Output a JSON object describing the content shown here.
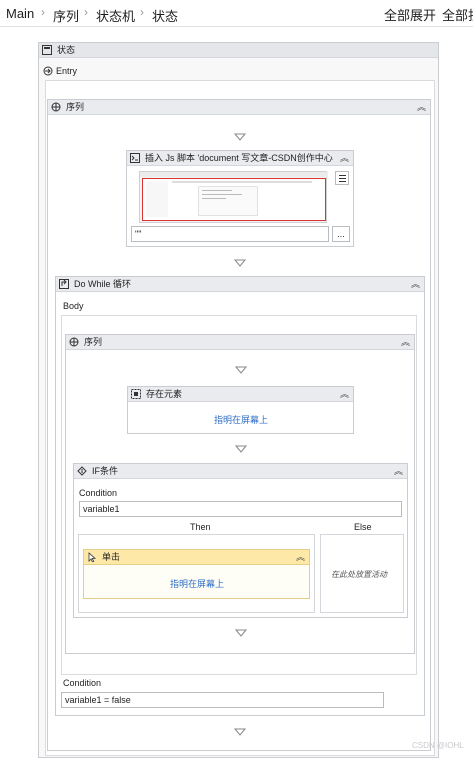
{
  "breadcrumb": [
    "Main",
    "序列",
    "状态机",
    "状态"
  ],
  "toolbar": {
    "expand_all": "全部展开",
    "collapse_all": "全部折"
  },
  "state": {
    "title": "状态",
    "entry_label": "Entry"
  },
  "outer_sequence": {
    "title": "序列"
  },
  "inject_js": {
    "title": "插入 Js 脚本 'document  写文章-CSDN创作中心",
    "field_value": "\"\"",
    "more_label": "..."
  },
  "do_while": {
    "title": "Do While 循环",
    "body_label": "Body",
    "condition_label": "Condition",
    "condition_value": "variable1 = false"
  },
  "inner_sequence": {
    "title": "序列"
  },
  "element_exists": {
    "title": "存在元素",
    "hint": "指明在屏幕上"
  },
  "if_block": {
    "title": "IF条件",
    "condition_label": "Condition",
    "condition_value": "variable1",
    "then_label": "Then",
    "else_label": "Else",
    "else_hint": "在此处放置活动"
  },
  "click": {
    "title": "单击",
    "hint": "指明在屏幕上"
  },
  "watermark": "CSDN @IOHL",
  "colors": {
    "header": "#e9ebee",
    "click_header": "#fde8a8",
    "link": "#2f6fc5",
    "border": "#c9ccd1"
  }
}
